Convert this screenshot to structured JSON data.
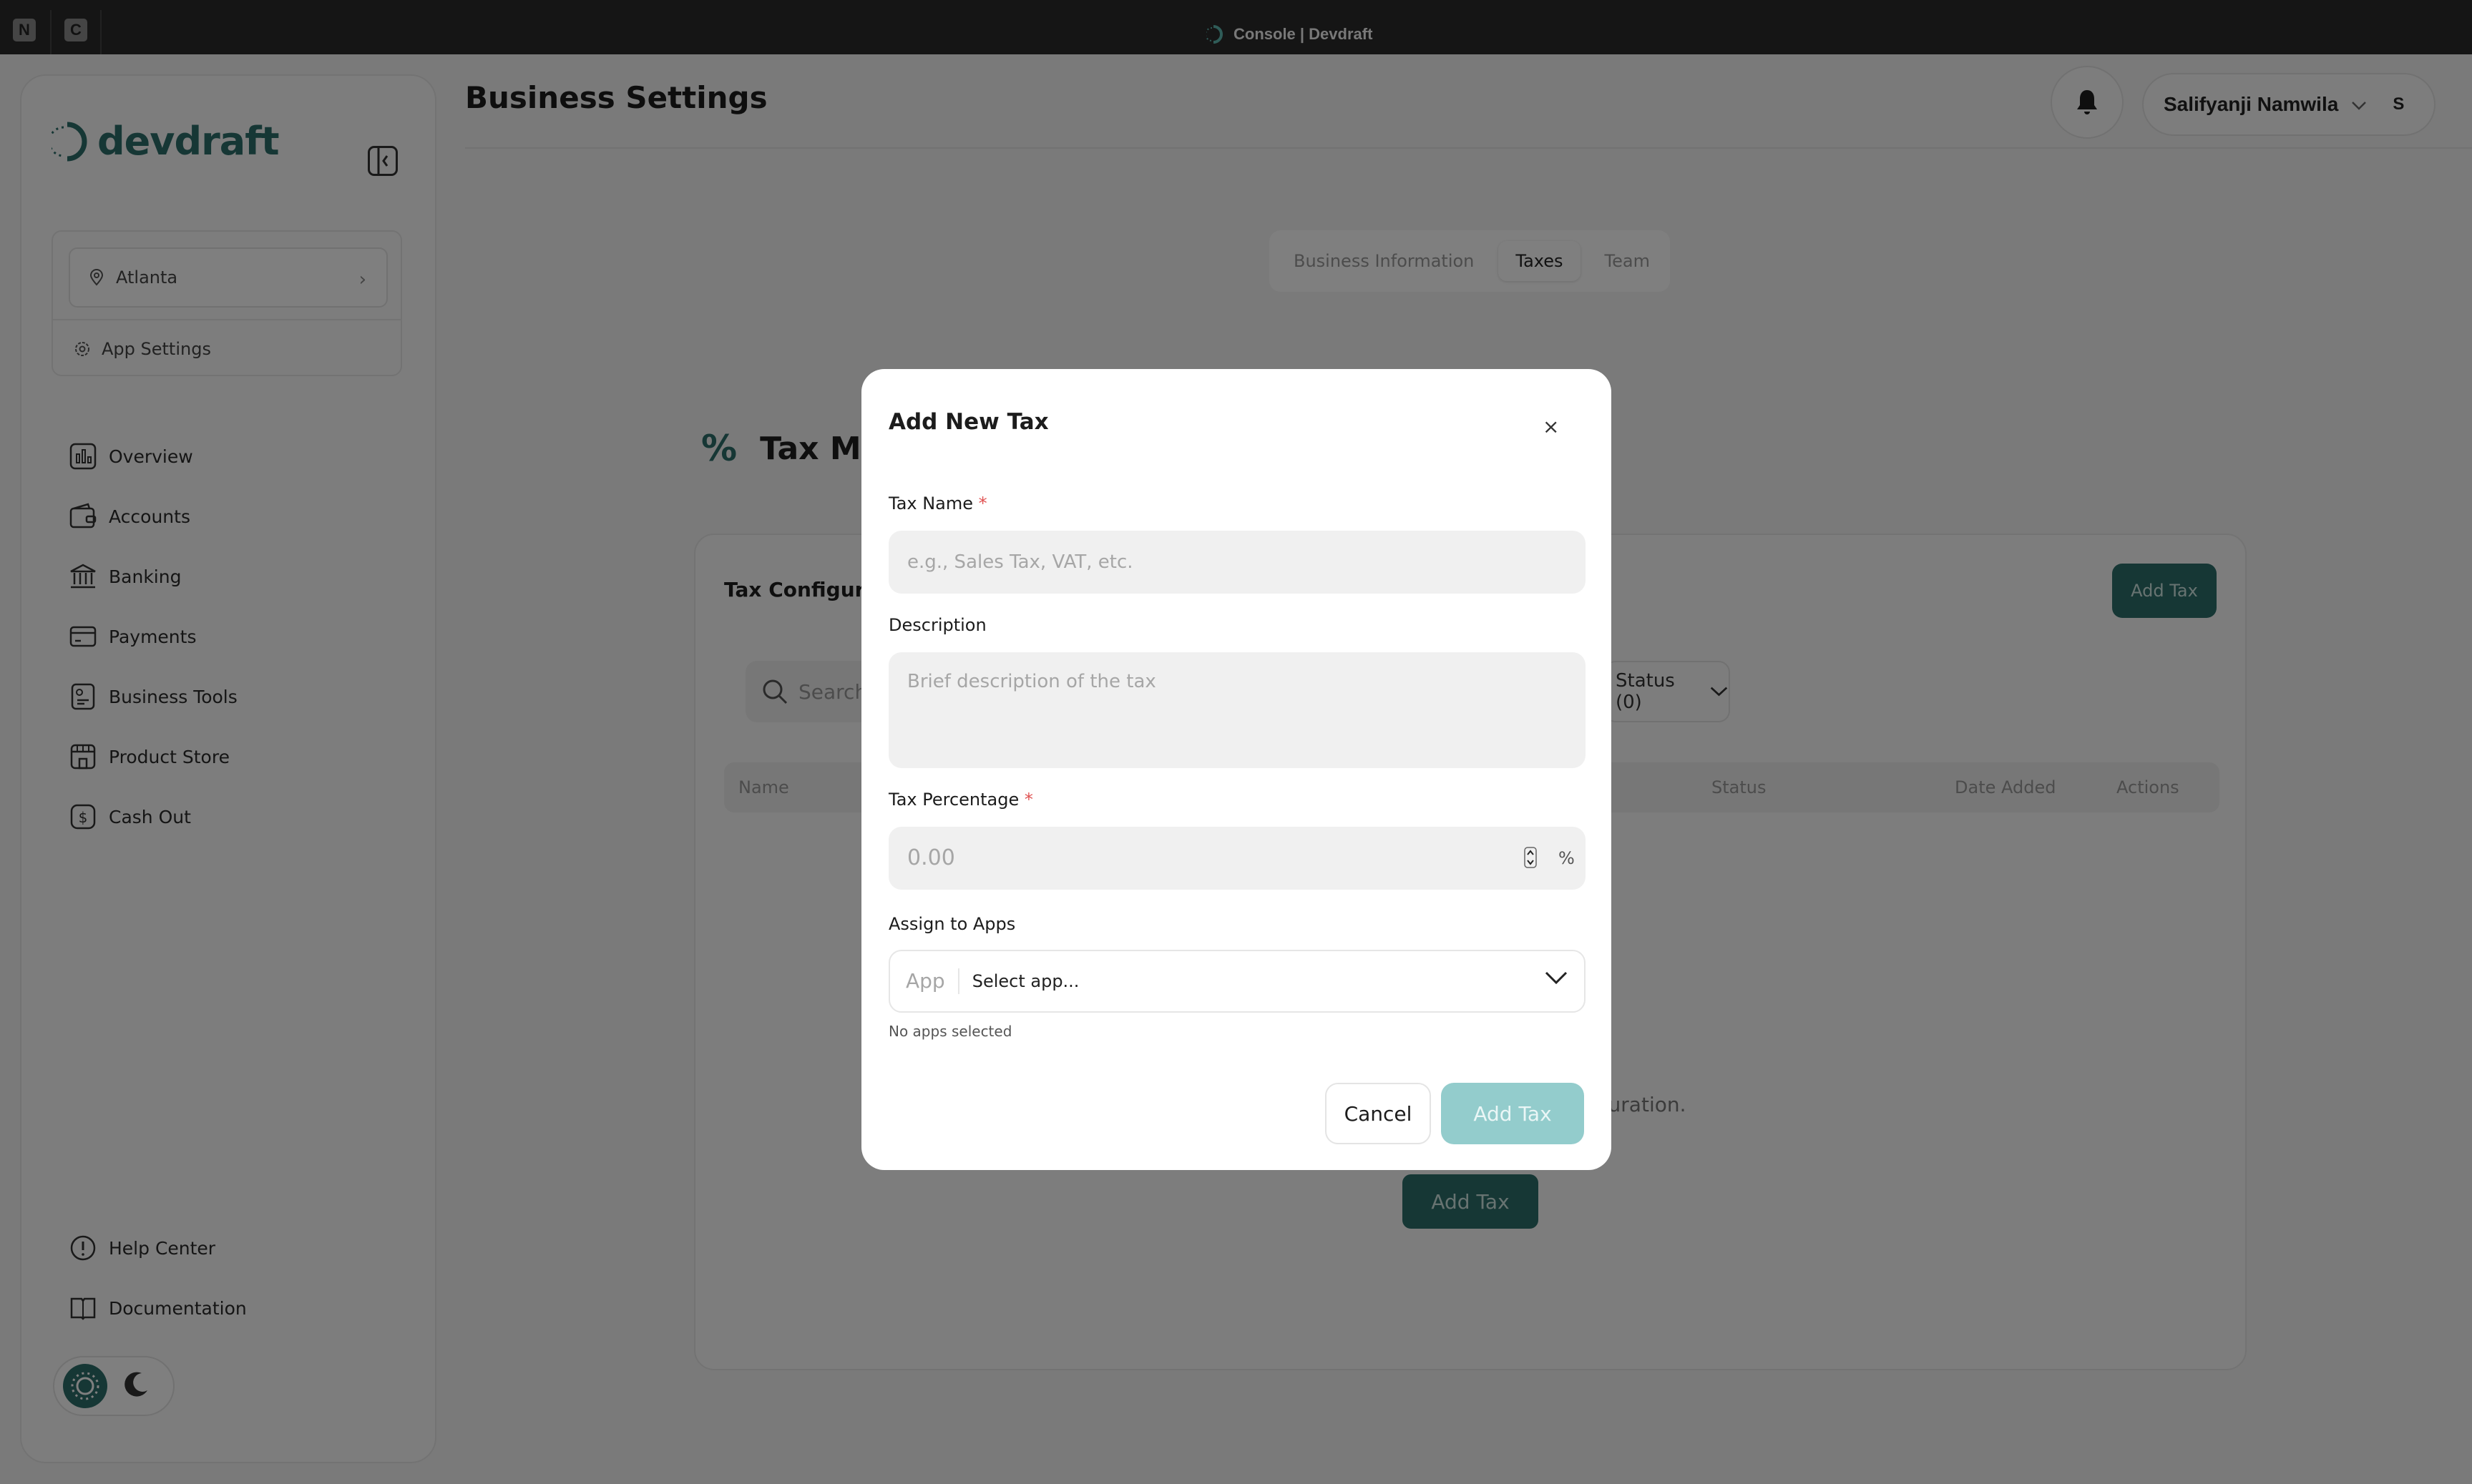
{
  "titlebar": {
    "apps": [
      "N",
      "C"
    ],
    "title": "Console | Devdraft"
  },
  "sidebar": {
    "brand": "devdraft",
    "location": "Atlanta",
    "app_settings": "App Settings",
    "items": [
      {
        "label": "Overview",
        "icon": "chart-icon"
      },
      {
        "label": "Accounts",
        "icon": "wallet-icon"
      },
      {
        "label": "Banking",
        "icon": "bank-icon"
      },
      {
        "label": "Payments",
        "icon": "card-icon"
      },
      {
        "label": "Business Tools",
        "icon": "document-icon"
      },
      {
        "label": "Product Store",
        "icon": "store-icon"
      },
      {
        "label": "Cash Out",
        "icon": "dollar-icon"
      }
    ],
    "bottom_items": [
      {
        "label": "Help Center",
        "icon": "info-icon"
      },
      {
        "label": "Documentation",
        "icon": "book-icon"
      }
    ]
  },
  "header": {
    "title": "Business Settings",
    "user_name": "Salifyanji Namwila",
    "avatar": "S"
  },
  "tabs": [
    {
      "label": "Business Information",
      "active": false
    },
    {
      "label": "Taxes",
      "active": true
    },
    {
      "label": "Team",
      "active": false
    }
  ],
  "main": {
    "section_title": "Tax Mar",
    "card_title": "Tax Configurat",
    "add_tax": "Add Tax",
    "search_placeholder": "Search",
    "status_filter": "Status (0)",
    "columns": [
      "Name",
      "Status",
      "Date Added",
      "Actions"
    ],
    "empty_text": "iguration.",
    "empty_add": "Add Tax"
  },
  "modal": {
    "title": "Add New Tax",
    "close": "×",
    "tax_name_label": "Tax Name",
    "tax_name_placeholder": "e.g., Sales Tax, VAT, etc.",
    "description_label": "Description",
    "description_placeholder": "Brief description of the tax",
    "percentage_label": "Tax Percentage",
    "percentage_placeholder": "0.00",
    "percent_sign": "%",
    "apps_label": "Assign to Apps",
    "apps_prefix": "App",
    "apps_value": "Select app...",
    "apps_hint": "No apps selected",
    "cancel": "Cancel",
    "submit": "Add Tax",
    "required_mark": "*"
  },
  "colors": {
    "accent": "#2d6e6a",
    "accent_light": "#93cccc",
    "required": "#e05252"
  }
}
